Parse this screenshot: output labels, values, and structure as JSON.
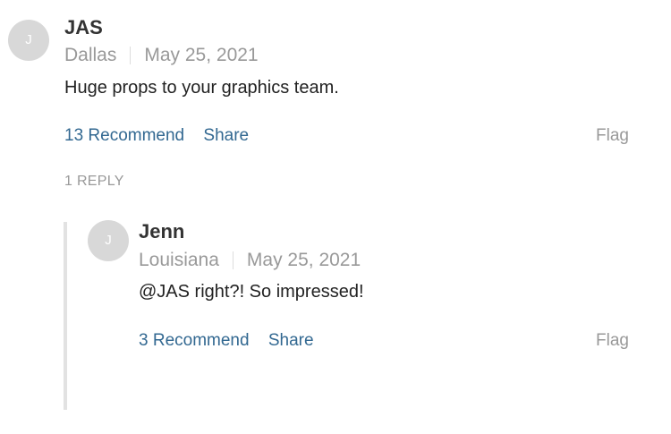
{
  "comment": {
    "avatar_initial": "J",
    "author": "JAS",
    "location": "Dallas",
    "date": "May 25, 2021",
    "text": "Huge props to your graphics team.",
    "recommend_label": "13 Recommend",
    "share_label": "Share",
    "flag_label": "Flag",
    "replies_label": "1 REPLY"
  },
  "reply": {
    "avatar_initial": "J",
    "author": "Jenn",
    "location": "Louisiana",
    "date": "May 25, 2021",
    "text": "@JAS right?! So impressed!",
    "recommend_label": "3 Recommend",
    "share_label": "Share",
    "flag_label": "Flag"
  }
}
